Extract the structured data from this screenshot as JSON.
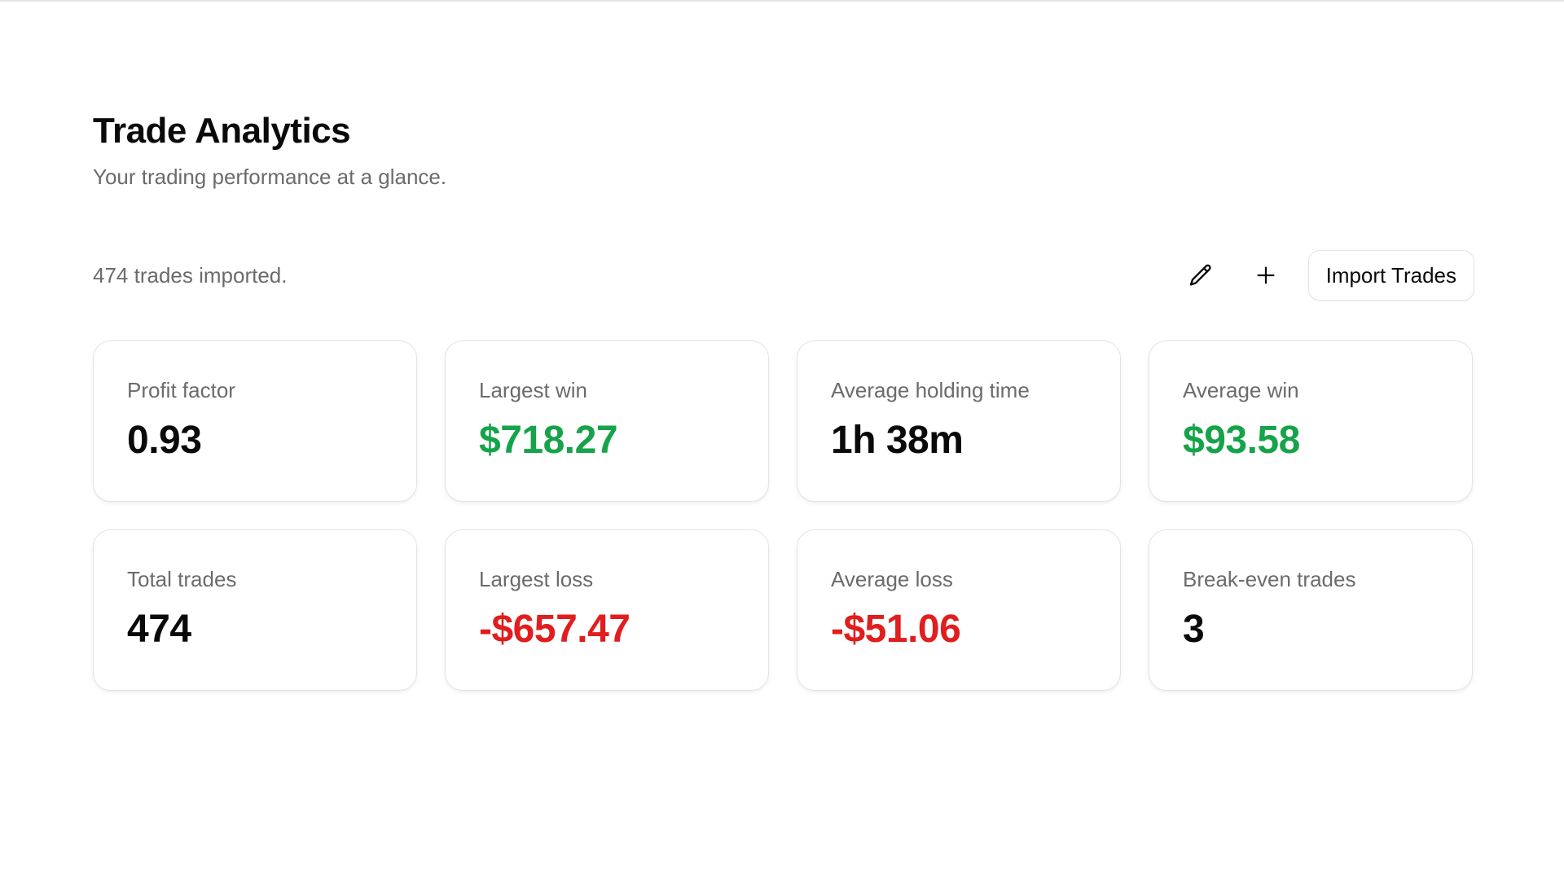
{
  "header": {
    "title": "Trade Analytics",
    "subtitle": "Your trading performance at a glance."
  },
  "toolbar": {
    "trade_count_text": "474 trades imported.",
    "edit_icon": "pencil-icon",
    "add_icon": "plus-icon",
    "import_label": "Import Trades"
  },
  "colors": {
    "positive": "#16a34a",
    "negative": "#e11d1d",
    "neutral": "#0a0a0a",
    "muted": "#6b6b6b"
  },
  "stats": [
    {
      "label": "Profit factor",
      "value": "0.93",
      "tone": "neutral"
    },
    {
      "label": "Largest win",
      "value": "$718.27",
      "tone": "positive"
    },
    {
      "label": "Average holding time",
      "value": "1h 38m",
      "tone": "neutral"
    },
    {
      "label": "Average win",
      "value": "$93.58",
      "tone": "positive"
    },
    {
      "label": "Total trades",
      "value": "474",
      "tone": "neutral"
    },
    {
      "label": "Largest loss",
      "value": "-$657.47",
      "tone": "negative"
    },
    {
      "label": "Average loss",
      "value": "-$51.06",
      "tone": "negative"
    },
    {
      "label": "Break-even trades",
      "value": "3",
      "tone": "neutral"
    }
  ]
}
